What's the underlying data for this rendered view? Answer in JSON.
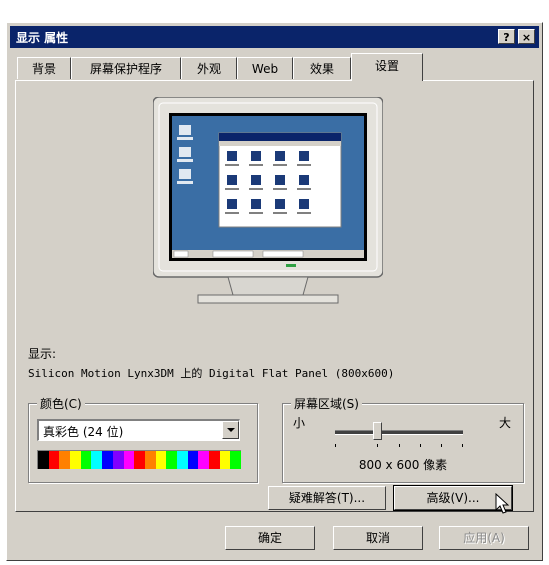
{
  "window": {
    "title": "显示 属性",
    "help_button": "?",
    "close_button": "×"
  },
  "tabs": [
    {
      "label": "背景"
    },
    {
      "label": "屏幕保护程序"
    },
    {
      "label": "外观"
    },
    {
      "label": "Web"
    },
    {
      "label": "效果"
    },
    {
      "label": "设置"
    }
  ],
  "active_tab": "设置",
  "display": {
    "label": "显示:",
    "device_text": "Silicon Motion Lynx3DM 上的 Digital Flat Panel (800x600)"
  },
  "colors": {
    "group_label": "颜色(C)",
    "selected": "真彩色 (24 位)",
    "spectrum": [
      "#000000",
      "#ff0000",
      "#ff8000",
      "#ffff00",
      "#00ff00",
      "#00ffff",
      "#0000ff",
      "#8000ff",
      "#ff00ff",
      "#ff0000",
      "#ff8000",
      "#ffff00",
      "#00ff00",
      "#00ffff",
      "#0000ff",
      "#ff00ff",
      "#ff0000",
      "#ffff00",
      "#00ff00"
    ]
  },
  "screen_area": {
    "group_label": "屏幕区域(S)",
    "min_label": "小",
    "max_label": "大",
    "resolution_text": "800 x 600 像素",
    "slider_fraction": 0.33
  },
  "buttons": {
    "troubleshoot": "疑难解答(T)...",
    "advanced": "高级(V)...",
    "ok": "确定",
    "cancel": "取消",
    "apply": "应用(A)"
  },
  "theme": {
    "face": "#d4d0c8",
    "title_bg": "#0a246a",
    "desktop": "#3a6ea5"
  }
}
